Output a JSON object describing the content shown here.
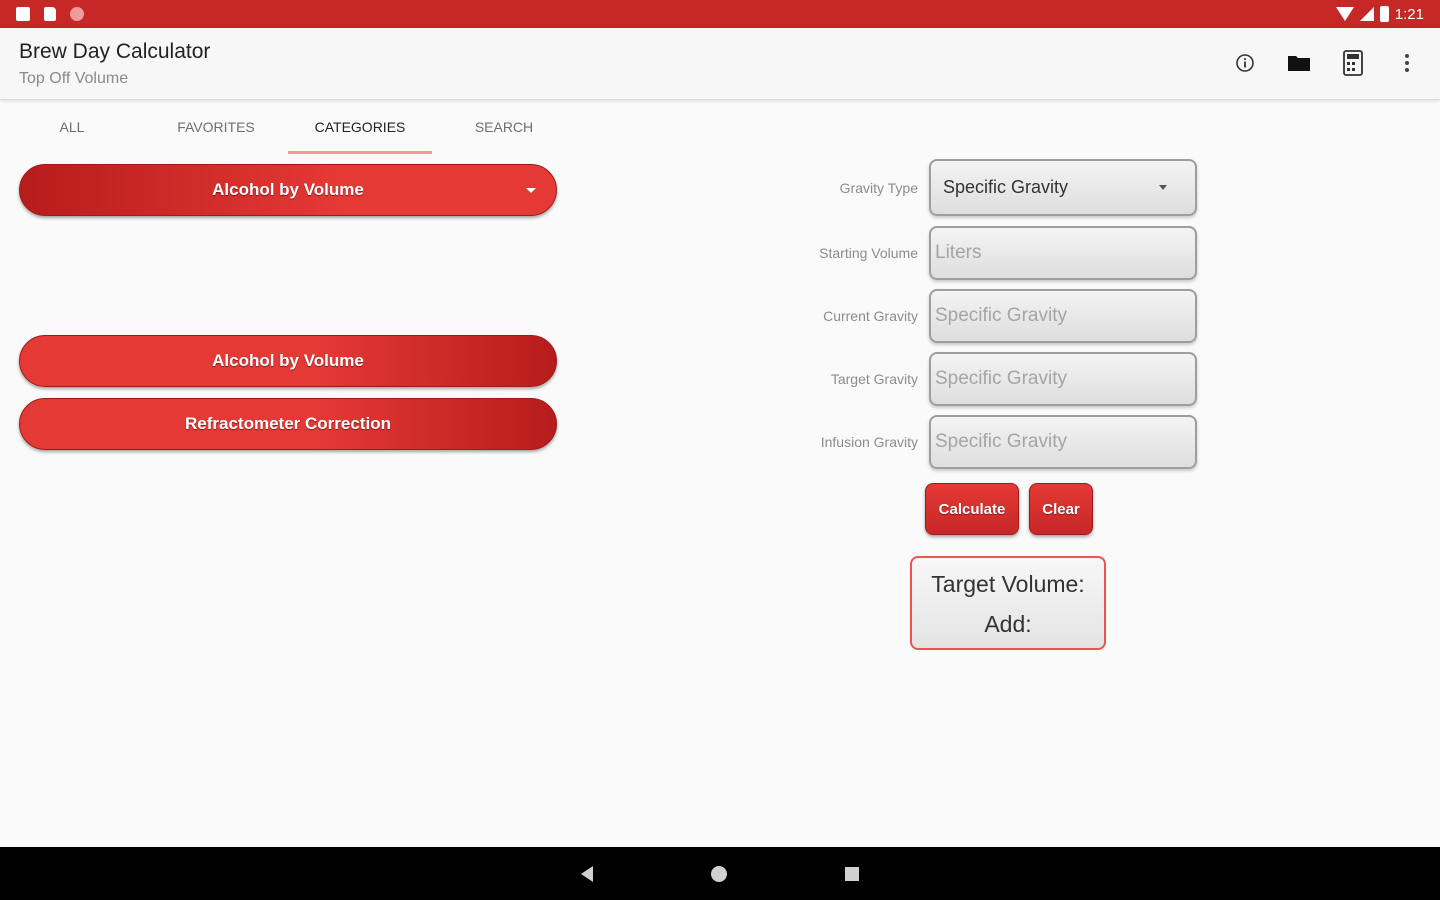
{
  "status_bar": {
    "time": "1:21",
    "icons": [
      "notification-square-icon",
      "sd-card-icon",
      "record-dot-icon",
      "wifi-icon",
      "signal-icon",
      "battery-icon"
    ]
  },
  "app_bar": {
    "title": "Brew Day Calculator",
    "subtitle": "Top Off Volume",
    "actions": [
      "info-icon",
      "folder-icon",
      "calculator-icon",
      "overflow-menu-icon"
    ]
  },
  "tabs": [
    {
      "label": "ALL",
      "active": false
    },
    {
      "label": "FAVORITES",
      "active": false
    },
    {
      "label": "CATEGORIES",
      "active": true
    },
    {
      "label": "SEARCH",
      "active": false
    }
  ],
  "category_dropdown": {
    "selected": "Alcohol by Volume"
  },
  "calculator_list": [
    {
      "label": "Alcohol by Volume"
    },
    {
      "label": "Refractometer Correction"
    }
  ],
  "form": {
    "gravity_type": {
      "label": "Gravity Type",
      "value": "Specific Gravity"
    },
    "starting_volume": {
      "label": "Starting Volume",
      "placeholder": "Liters"
    },
    "current_gravity": {
      "label": "Current Gravity",
      "placeholder": "Specific Gravity"
    },
    "target_gravity": {
      "label": "Target Gravity",
      "placeholder": "Specific Gravity"
    },
    "infusion_gravity": {
      "label": "Infusion Gravity",
      "placeholder": "Specific Gravity"
    }
  },
  "buttons": {
    "calculate": "Calculate",
    "clear": "Clear"
  },
  "result": {
    "target_volume": "Target Volume:",
    "add": "Add:"
  },
  "colors": {
    "primary": "#c62828",
    "accent": "#e53935",
    "tab_indicator": "#ef9a9a",
    "result_border": "#ef5350"
  }
}
